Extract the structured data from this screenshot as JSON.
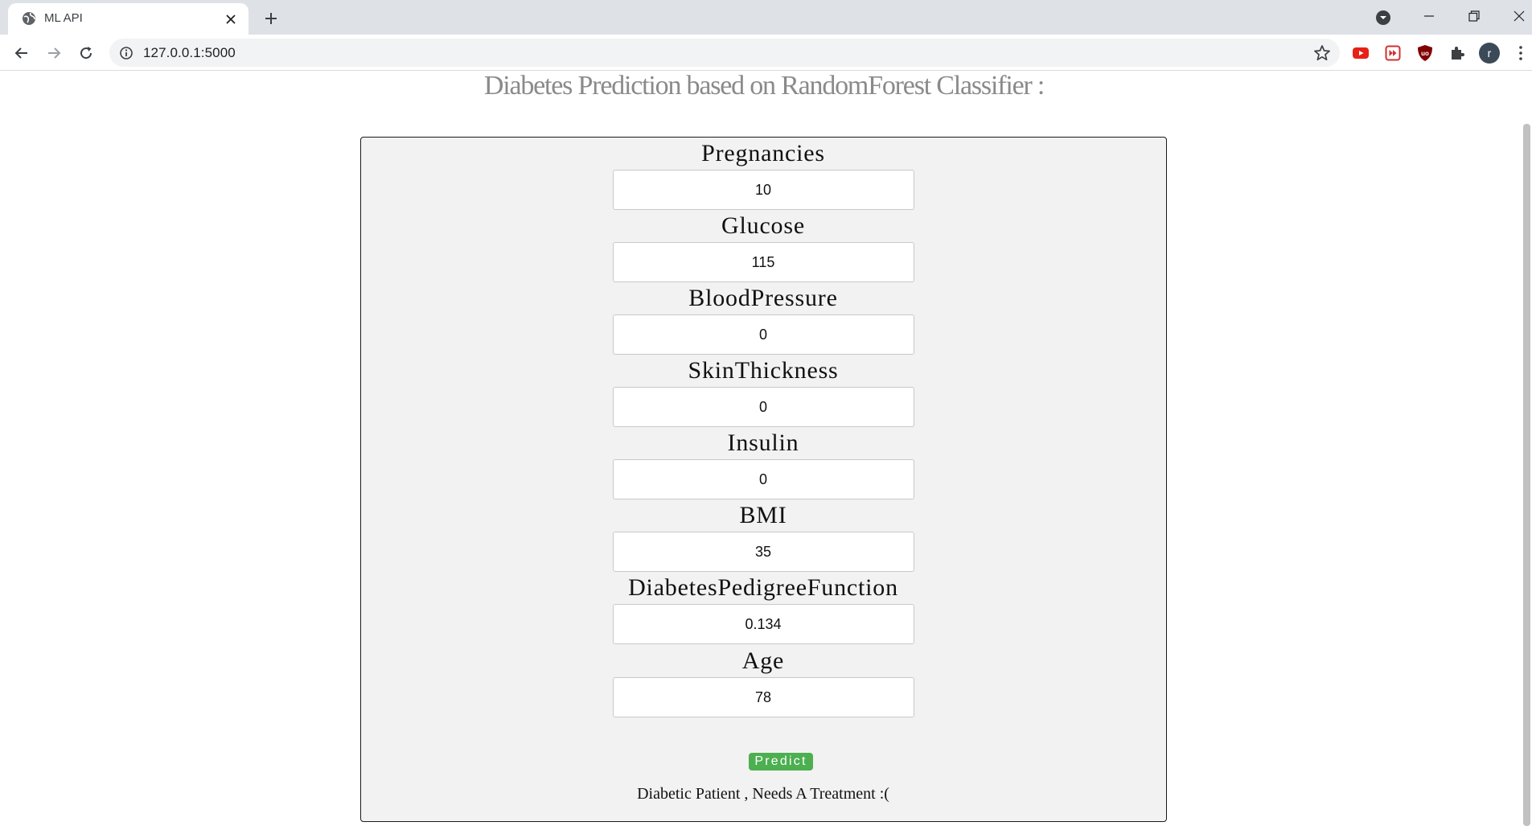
{
  "browser": {
    "tab_title": "ML API",
    "url": "127.0.0.1:5000",
    "profile_initial": "r"
  },
  "page": {
    "title": "Diabetes Prediction based on RandomForest Classifier :",
    "fields": [
      {
        "label": "Pregnancies",
        "value": "10"
      },
      {
        "label": "Glucose",
        "value": "115"
      },
      {
        "label": "BloodPressure",
        "value": "0"
      },
      {
        "label": "SkinThickness",
        "value": "0"
      },
      {
        "label": "Insulin",
        "value": "0"
      },
      {
        "label": "BMI",
        "value": "35"
      },
      {
        "label": "DiabetesPedigreeFunction",
        "value": "0.134"
      },
      {
        "label": "Age",
        "value": "78"
      }
    ],
    "predict_label": "Predict",
    "result_text": "Diabetic Patient , Needs A Treatment :("
  },
  "colors": {
    "predict_button": "#4caf50",
    "title_text": "#8a8a8a",
    "form_background": "#f2f2f2"
  },
  "icons": {
    "tab_favicon": "globe-icon",
    "tab_close": "close-icon",
    "new_tab": "plus-icon",
    "back": "arrow-left-icon",
    "forward": "arrow-right-icon",
    "reload": "reload-icon",
    "site_info": "info-icon",
    "bookmark": "star-icon",
    "extensions": [
      "youtube-icon",
      "skip-ad-icon",
      "ublock-icon",
      "puzzle-icon"
    ]
  }
}
